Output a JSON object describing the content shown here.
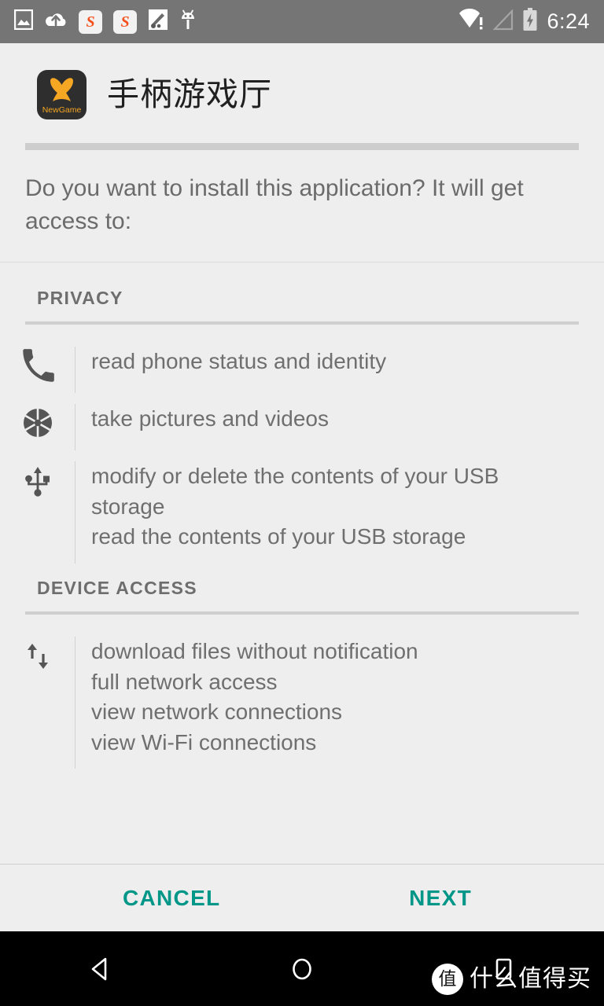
{
  "status_bar": {
    "time": "6:24",
    "background": "#757575",
    "left_icons": [
      {
        "name": "screenshot-icon",
        "label": "screenshot"
      },
      {
        "name": "cloud-upload-icon",
        "label": "cloud upload"
      },
      {
        "name": "sogou-app-icon-1",
        "label": "S"
      },
      {
        "name": "sogou-app-icon-2",
        "label": "S"
      },
      {
        "name": "tool-icon",
        "label": "tool"
      },
      {
        "name": "android-robot-icon",
        "label": "android"
      }
    ],
    "right_icons": [
      {
        "name": "wifi-warning-icon",
        "label": "wifi no internet"
      },
      {
        "name": "cell-signal-empty-icon",
        "label": "no signal"
      },
      {
        "name": "battery-charging-icon",
        "label": "charging"
      }
    ]
  },
  "app": {
    "name": "手柄游戏厅",
    "icon_label": "NewGame",
    "icon_background": "#2e2e2e",
    "icon_accent": "#f5a623"
  },
  "prompt": {
    "text": "Do you want to install this application? It will get access to:"
  },
  "sections": [
    {
      "title": "PRIVACY",
      "groups": [
        {
          "icon": "phone-icon",
          "lines": [
            "read phone status and identity"
          ]
        },
        {
          "icon": "camera-aperture-icon",
          "lines": [
            "take pictures and videos"
          ]
        },
        {
          "icon": "usb-icon",
          "lines": [
            "modify or delete the contents of your USB storage",
            "read the contents of your USB storage"
          ]
        }
      ]
    },
    {
      "title": "DEVICE ACCESS",
      "groups": [
        {
          "icon": "network-sync-icon",
          "lines": [
            "download files without notification",
            "full network access",
            "view network connections",
            "view Wi-Fi connections"
          ]
        }
      ]
    }
  ],
  "buttons": {
    "cancel": "CANCEL",
    "next": "NEXT",
    "accent_color": "#009688"
  },
  "nav_bar": {
    "back": "back-triangle",
    "home": "home-circle",
    "recents": "recents-square"
  },
  "watermark": {
    "logo": "值",
    "text": "什么值得买"
  }
}
